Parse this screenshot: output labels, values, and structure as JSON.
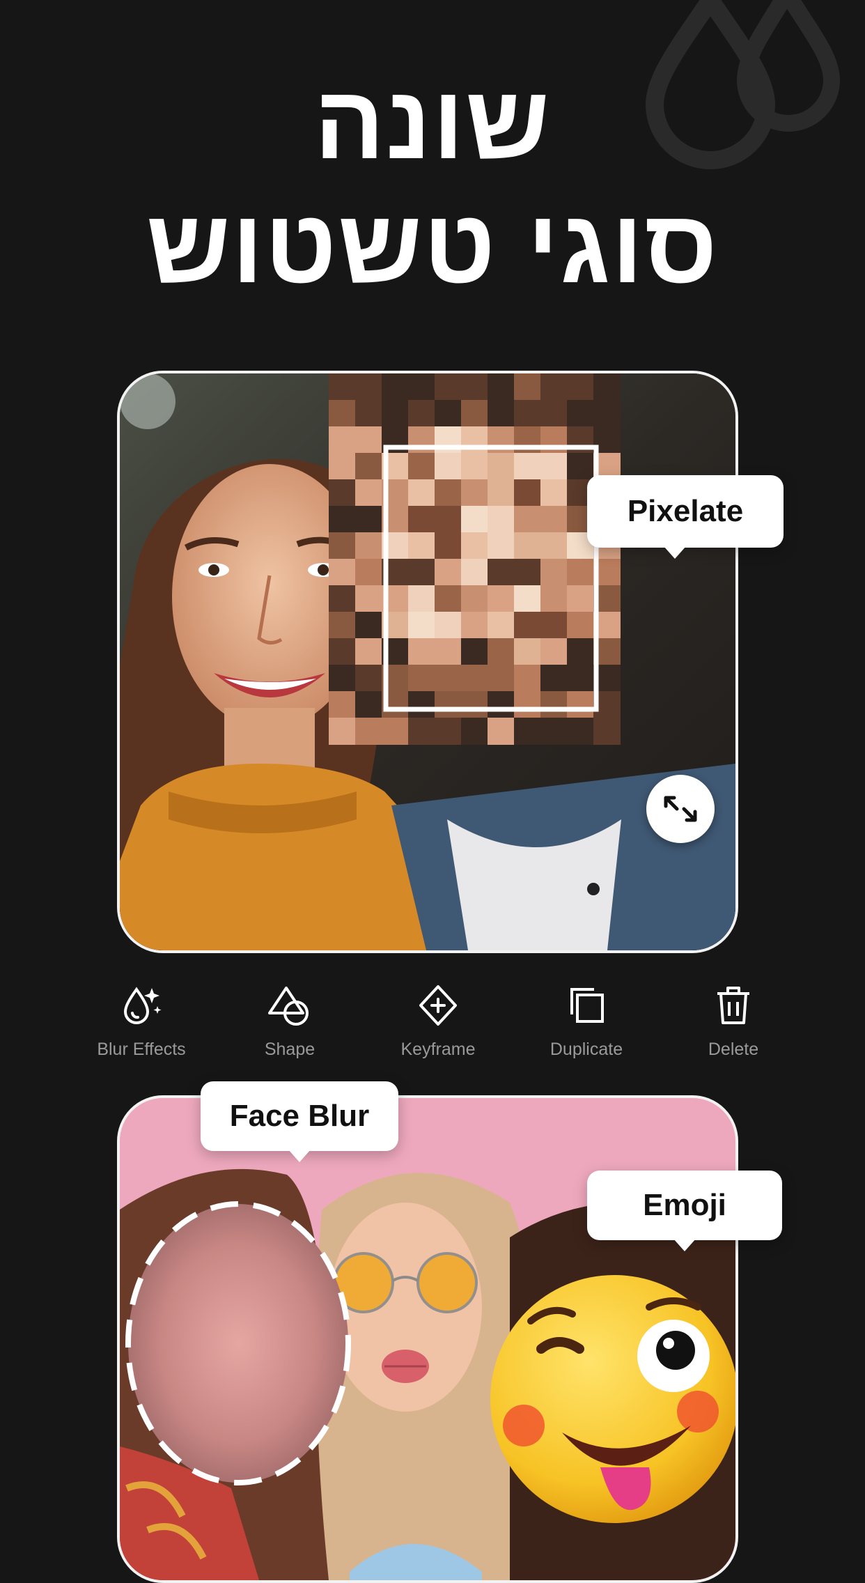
{
  "headline": {
    "line1": "שונה",
    "line2": "סוגי טשטוש"
  },
  "top_card": {
    "label": "Pixelate",
    "resize_icon": "resize-arrows-icon"
  },
  "toolbar": {
    "items": [
      {
        "label": "Blur Effects",
        "icon": "blur-drop-sparkle-icon"
      },
      {
        "label": "Shape",
        "icon": "shape-icon"
      },
      {
        "label": "Keyframe",
        "icon": "keyframe-diamond-icon"
      },
      {
        "label": "Duplicate",
        "icon": "duplicate-icon"
      },
      {
        "label": "Delete",
        "icon": "trash-icon"
      }
    ]
  },
  "bottom_card": {
    "face_blur_label": "Face Blur",
    "emoji_label": "Emoji"
  },
  "colors": {
    "background": "#161616",
    "card_border": "#f2f2f2",
    "toolbar_label": "#9a9a9a",
    "sweater": "#d68a27",
    "pink_bg": "#eea8bd",
    "emoji": "#f7c325"
  }
}
